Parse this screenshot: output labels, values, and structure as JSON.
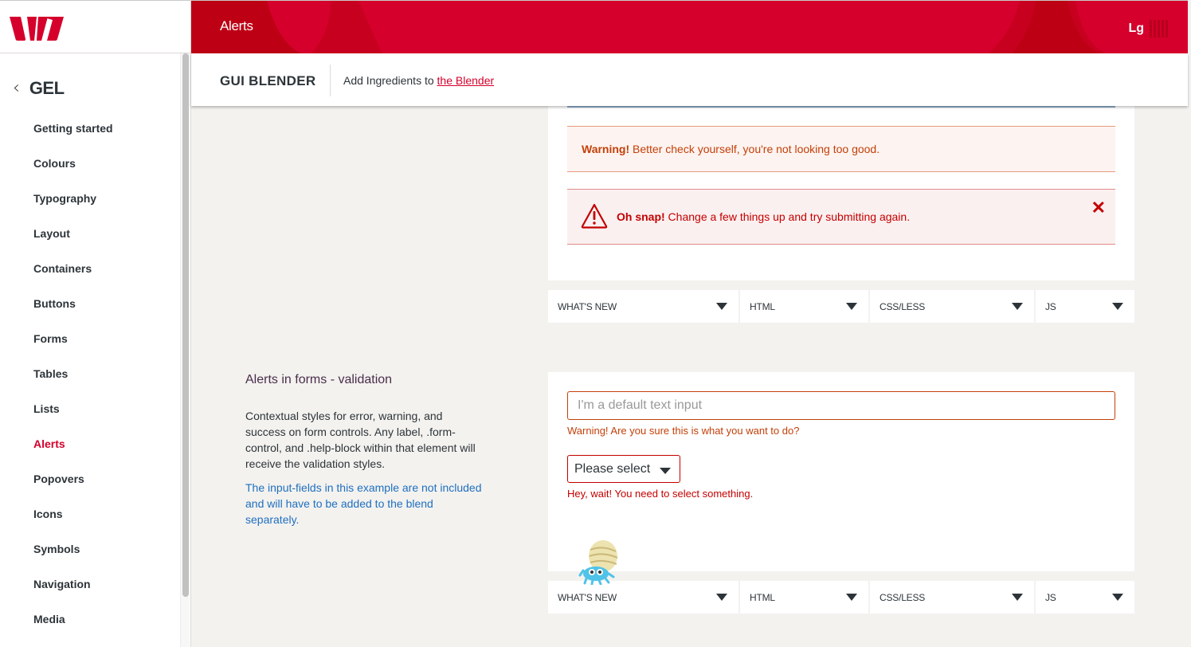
{
  "brand": {
    "logo": "westpac-logo",
    "primary_color": "#d5002b"
  },
  "header": {
    "title": "Alerts",
    "user_initials": "Lg",
    "menu_icon": "bars-icon"
  },
  "subheader": {
    "app_name": "GUI BLENDER",
    "prefix": "Add Ingredients to ",
    "link_text": "the Blender"
  },
  "sidebar": {
    "back_icon": "chevron-left-icon",
    "section_title": "GEL",
    "items": [
      {
        "label": "Getting started",
        "active": false
      },
      {
        "label": "Colours",
        "active": false
      },
      {
        "label": "Typography",
        "active": false
      },
      {
        "label": "Layout",
        "active": false
      },
      {
        "label": "Containers",
        "active": false
      },
      {
        "label": "Buttons",
        "active": false
      },
      {
        "label": "Forms",
        "active": false
      },
      {
        "label": "Tables",
        "active": false
      },
      {
        "label": "Lists",
        "active": false
      },
      {
        "label": "Alerts",
        "active": true
      },
      {
        "label": "Popovers",
        "active": false
      },
      {
        "label": "Icons",
        "active": false
      },
      {
        "label": "Symbols",
        "active": false
      },
      {
        "label": "Navigation",
        "active": false
      },
      {
        "label": "Media",
        "active": false
      }
    ]
  },
  "alerts": {
    "warning": {
      "strong": "Warning!",
      "text": " Better check yourself, you're not looking too good."
    },
    "danger": {
      "strong": "Oh snap!",
      "text": " Change a few things up and try submitting again.",
      "icon": "warning-triangle-icon",
      "close_icon": "close-icon"
    }
  },
  "code_tabs": [
    "WHAT'S NEW",
    "HTML",
    "CSS/LESS",
    "JS"
  ],
  "section": {
    "title": "Alerts in forms - validation",
    "description": "Contextual styles for error, warning, and success on form controls. Any label, .form-control, and .help-block within that element will receive the validation styles.",
    "note": "The input-fields in this example are not included and will have to be added to the blend separately."
  },
  "form": {
    "text_input": {
      "placeholder": "I'm a default text input",
      "value": ""
    },
    "warning_help": "Warning! Are you sure this is what you want to do?",
    "select": {
      "selected": "Please select"
    },
    "error_help": "Hey, wait! You need to select something."
  }
}
